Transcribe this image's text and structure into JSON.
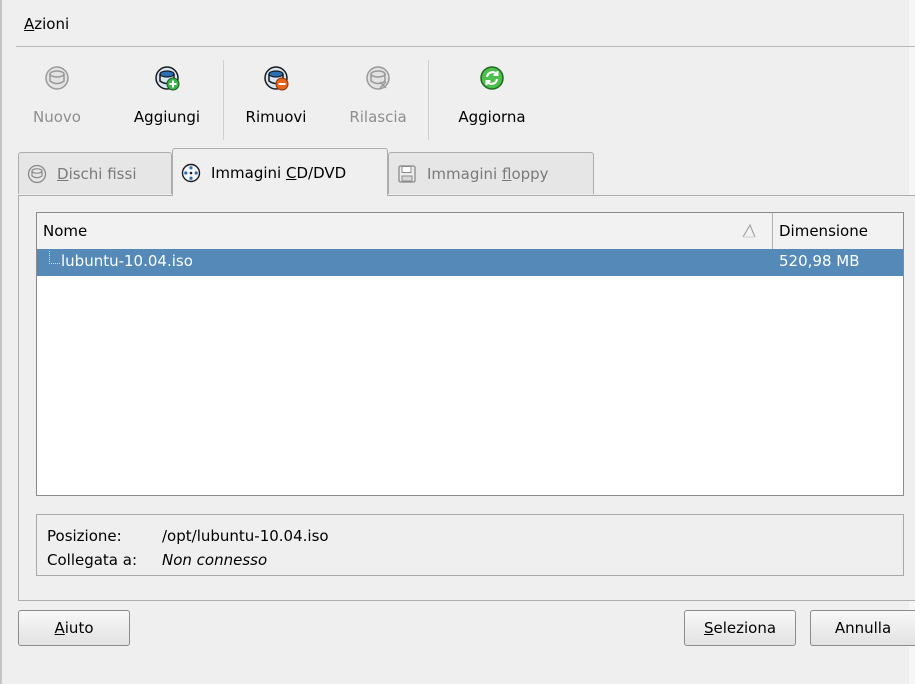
{
  "menubar": {
    "azioni_first": "A",
    "azioni_rest": "zioni"
  },
  "toolbar": {
    "buttons": [
      {
        "label": "Nuovo",
        "icon": "hard-disk-new-icon",
        "enabled": false
      },
      {
        "label": "Aggiungi",
        "icon": "hard-disk-add-icon",
        "enabled": true
      },
      {
        "label": "Rimuovi",
        "icon": "hard-disk-remove-icon",
        "enabled": true
      },
      {
        "label": "Rilascia",
        "icon": "hard-disk-release-icon",
        "enabled": false
      },
      {
        "label": "Aggiorna",
        "icon": "refresh-icon",
        "enabled": true
      }
    ]
  },
  "tabs": [
    {
      "pre": "",
      "acc": "D",
      "post": "ischi fissi",
      "icon": "hard-disk-icon",
      "active": false
    },
    {
      "pre": "Immagini ",
      "acc": "C",
      "post": "D/DVD",
      "icon": "cd-dvd-icon",
      "active": true
    },
    {
      "pre": "Immagini ",
      "acc": "f",
      "post": "loppy",
      "icon": "floppy-icon",
      "active": false
    }
  ],
  "list": {
    "columns": {
      "name": "Nome",
      "size": "Dimensione"
    },
    "rows": [
      {
        "name": "lubuntu-10.04.iso",
        "size": "520,98 MB",
        "selected": true
      }
    ]
  },
  "details": {
    "position_label": "Posizione:",
    "position_value": "/opt/lubuntu-10.04.iso",
    "attached_label": "Collegata a:",
    "attached_value": "Non connesso"
  },
  "buttons": {
    "help": {
      "acc": "A",
      "rest": "iuto"
    },
    "select": {
      "acc": "S",
      "rest": "eleziona"
    },
    "cancel": "Annulla"
  },
  "colors": {
    "selection": "#5489b8",
    "background": "#efefef"
  }
}
